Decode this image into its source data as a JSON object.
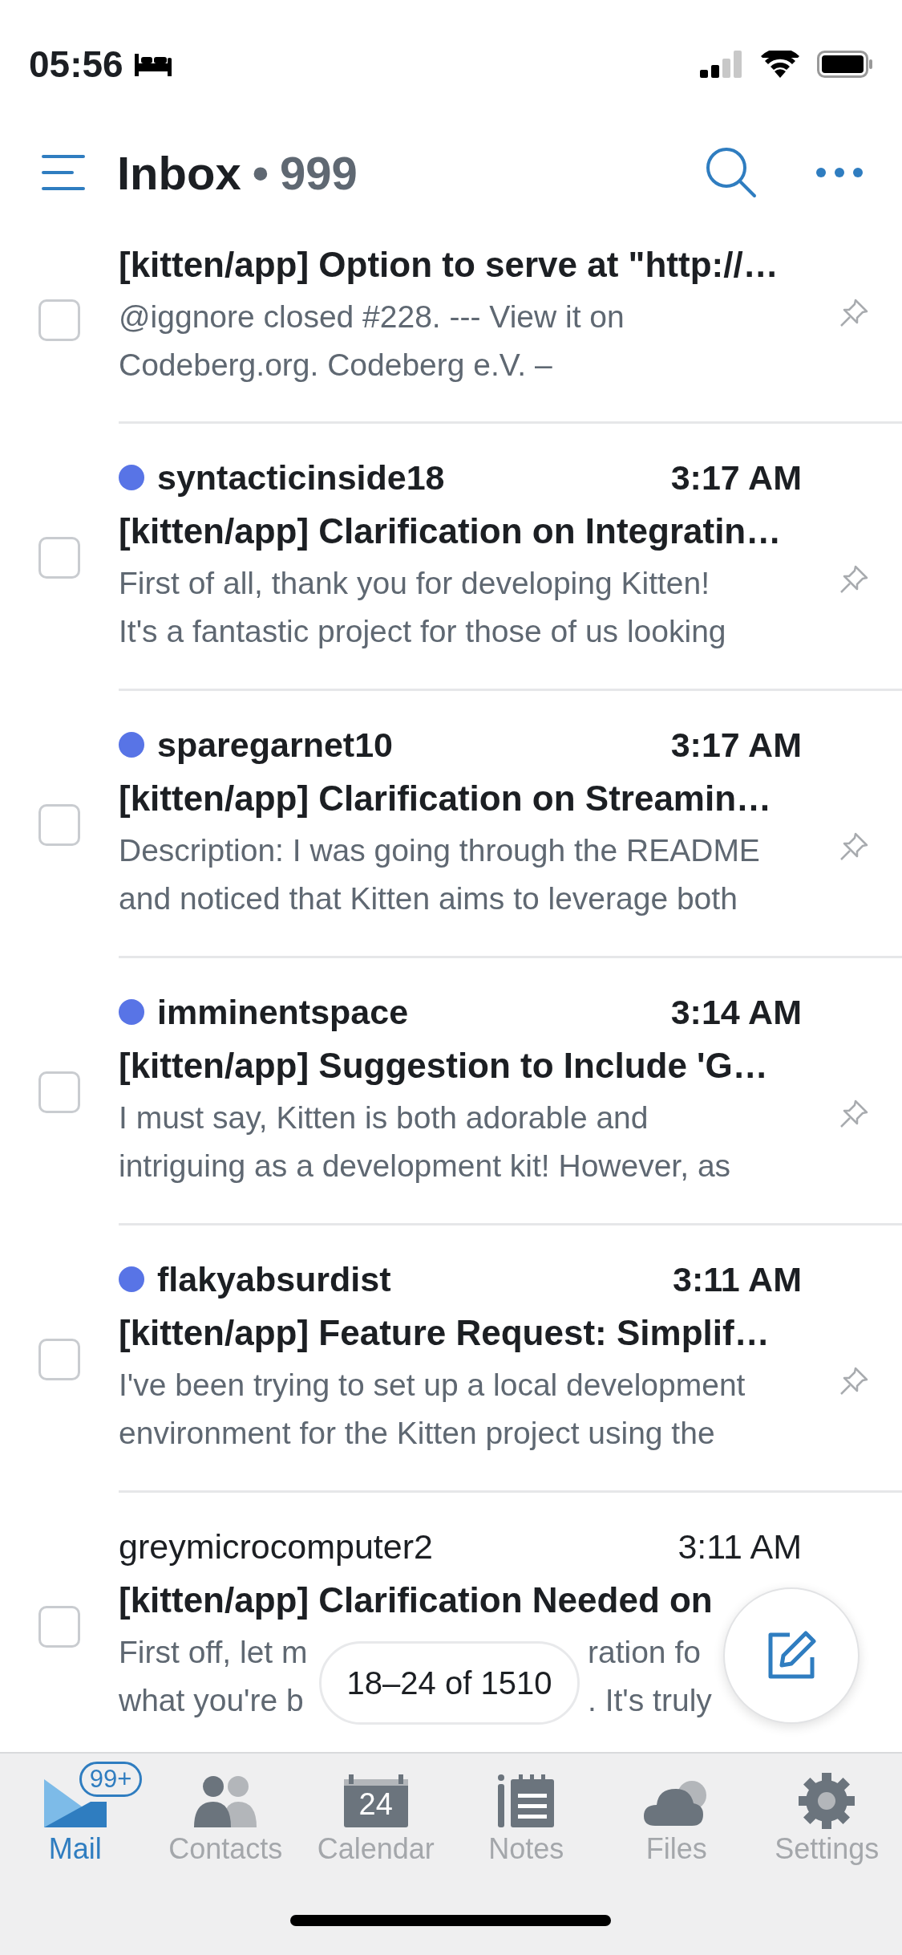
{
  "status_bar": {
    "time": "05:56"
  },
  "header": {
    "title": "Inbox",
    "separator": "•",
    "count": "999"
  },
  "messages": [
    {
      "checked": false,
      "subject": "[kitten/app] Option to serve at \"http://…",
      "preview": [
        "@iggnore closed #228. --- View it on",
        "Codeberg.org. Codeberg e.V. –"
      ]
    },
    {
      "checked": false,
      "sender": "syntacticinside18",
      "time": "3:17 AM",
      "unread": true,
      "subject": "[kitten/app] Clarification on Integratin…",
      "preview": [
        "First of all, thank you for developing Kitten!",
        "It's a fantastic project for those of us looking"
      ]
    },
    {
      "checked": false,
      "sender": "sparegarnet10",
      "time": "3:17 AM",
      "unread": true,
      "subject": "[kitten/app] Clarification on Streamin…",
      "preview": [
        "Description: I was going through the README",
        "and noticed that Kitten aims to leverage both"
      ]
    },
    {
      "checked": false,
      "sender": "imminentspace",
      "time": "3:14 AM",
      "unread": true,
      "subject": "[kitten/app] Suggestion to Include 'G…",
      "preview": [
        "I must say, Kitten is both adorable and",
        "intriguing as a development kit! However, as"
      ]
    },
    {
      "checked": false,
      "sender": "flakyabsurdist",
      "time": "3:11 AM",
      "unread": true,
      "subject": "[kitten/app] Feature Request: Simplif…",
      "preview": [
        "I've been trying to set up a local development",
        "environment for the Kitten project using the"
      ]
    },
    {
      "checked": false,
      "sender": "greymicrocomputer2",
      "time": "3:11 AM",
      "unread": false,
      "subject": "[kitten/app] Clarification Needed on",
      "preview_split": [
        [
          "First off, let m",
          "ration fo"
        ],
        [
          "what you're b",
          ". It's truly"
        ]
      ]
    }
  ],
  "page_indicator": "18–24 of 1510",
  "tabs": [
    {
      "kind": "mail",
      "label": "Mail",
      "selected": true,
      "badge": "99+"
    },
    {
      "kind": "contacts",
      "label": "Contacts",
      "selected": false
    },
    {
      "kind": "calendar",
      "label": "Calendar",
      "selected": false,
      "icon_text": "24"
    },
    {
      "kind": "notes",
      "label": "Notes",
      "selected": false
    },
    {
      "kind": "files",
      "label": "Files",
      "selected": false
    },
    {
      "kind": "settings",
      "label": "Settings",
      "selected": false
    }
  ]
}
